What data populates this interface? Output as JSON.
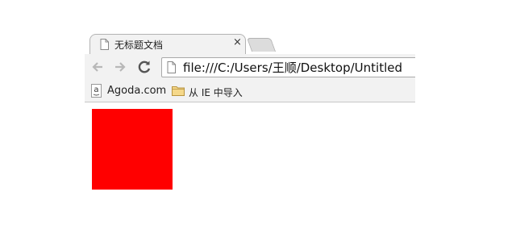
{
  "tab": {
    "title": "无标题文档",
    "close": "×"
  },
  "address_bar": {
    "url": "file:///C:/Users/王顺/Desktop/Untitled"
  },
  "bookmarks": [
    {
      "label": "Agoda.com",
      "icon": "agoda-icon"
    },
    {
      "label": "从 IE 中导入",
      "icon": "folder-icon"
    }
  ],
  "icons": {
    "tab": "document-icon",
    "back": "back-arrow-icon",
    "forward": "forward-arrow-icon",
    "reload": "reload-icon",
    "page": "document-icon"
  },
  "page": {
    "box_color": "#ff0000"
  }
}
